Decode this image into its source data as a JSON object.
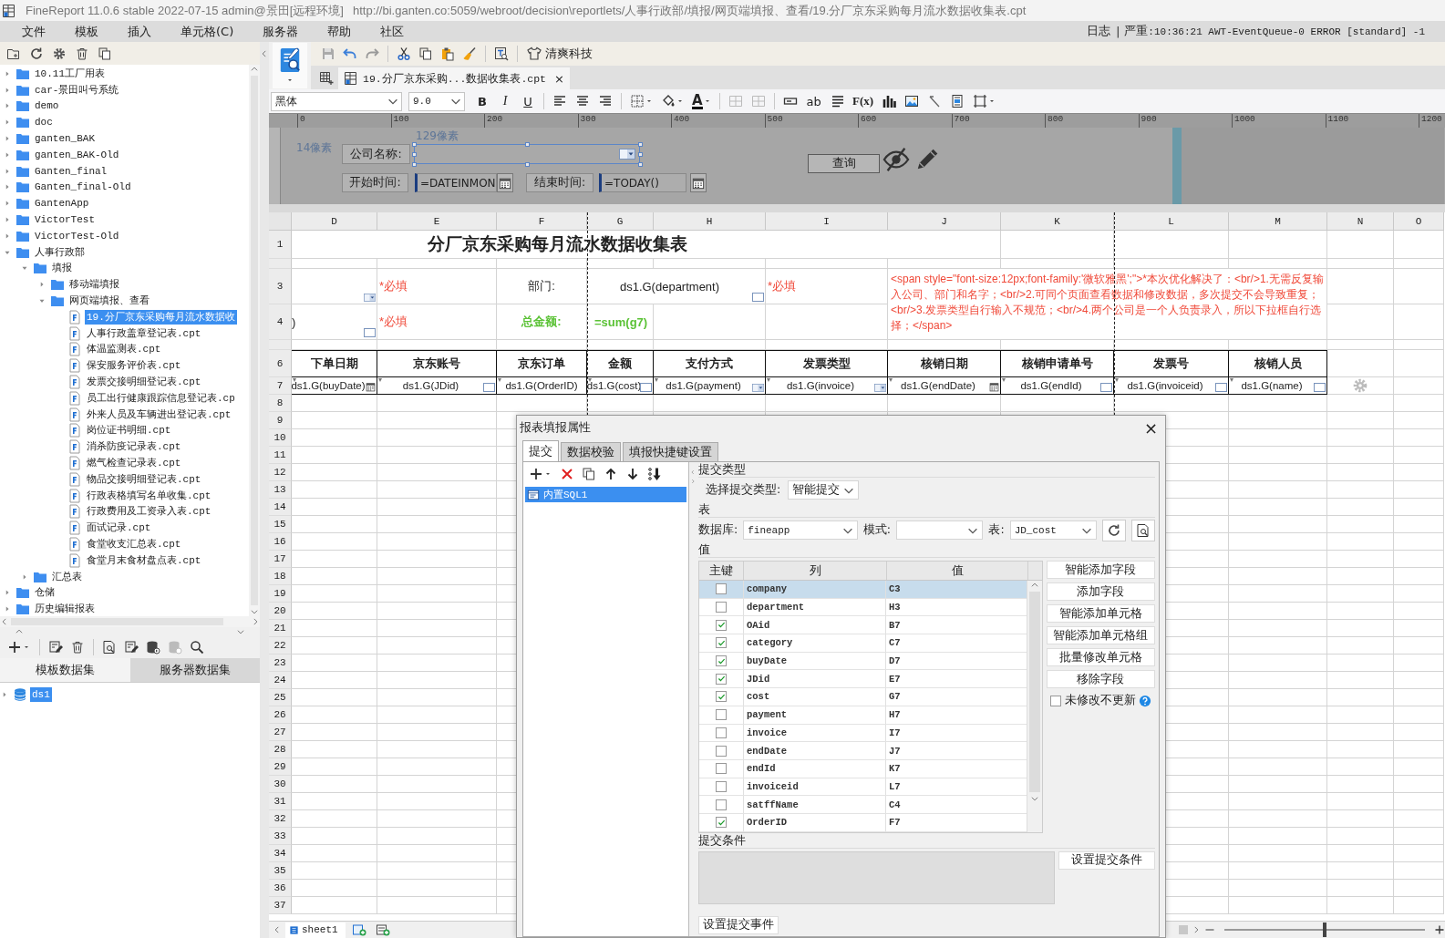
{
  "window": {
    "title": "FineReport 11.0.6 stable 2022-07-15 admin@景田[远程环境]",
    "url": "http://bi.ganten.co:5059/webroot/decision\\reportlets/人事行政部/填报/网页端填报、查看/19.分厂京东采购每月流水数据收集表.cpt"
  },
  "menu": {
    "items": [
      "文件",
      "模板",
      "插入",
      "单元格(C)",
      "服务器",
      "帮助",
      "社区"
    ],
    "log_label": "日志",
    "log_separator": "|",
    "log_level": "严重",
    "log_message": ":10:36:21 AWT-EventQueue-0 ERROR [standard] -1"
  },
  "template_tree": [
    {
      "label": "10.11工厂用表",
      "kind": "folder",
      "expanded": false,
      "selected": false
    },
    {
      "label": "car-景田叫号系统",
      "kind": "folder",
      "expanded": false,
      "selected": false
    },
    {
      "label": "demo",
      "kind": "folder",
      "expanded": false,
      "selected": false
    },
    {
      "label": "doc",
      "kind": "folder",
      "expanded": false,
      "selected": false
    },
    {
      "label": "ganten_BAK",
      "kind": "folder",
      "expanded": false,
      "selected": false
    },
    {
      "label": "ganten_BAK-Old",
      "kind": "folder",
      "expanded": false,
      "selected": false
    },
    {
      "label": "Ganten_final",
      "kind": "folder",
      "expanded": false,
      "selected": false
    },
    {
      "label": "Ganten_final-Old",
      "kind": "folder",
      "expanded": false,
      "selected": false
    },
    {
      "label": "GantenApp",
      "kind": "folder",
      "expanded": false,
      "selected": false
    },
    {
      "label": "VictorTest",
      "kind": "folder",
      "expanded": false,
      "selected": false
    },
    {
      "label": "VictorTest-Old",
      "kind": "folder",
      "expanded": false,
      "selected": false
    },
    {
      "label": "人事行政部",
      "kind": "folder",
      "expanded": true,
      "selected": false,
      "children": [
        {
          "label": "填报",
          "kind": "folder",
          "expanded": true,
          "selected": false,
          "children": [
            {
              "label": "移动端填报",
              "kind": "folder",
              "expanded": false,
              "selected": false
            },
            {
              "label": "网页端填报、查看",
              "kind": "folder",
              "expanded": true,
              "selected": false,
              "children": [
                {
                  "label": "19.分厂京东采购每月流水数据收",
                  "kind": "file",
                  "selected": true
                },
                {
                  "label": "人事行政盖章登记表.cpt",
                  "kind": "file",
                  "selected": false
                },
                {
                  "label": "体温监测表.cpt",
                  "kind": "file",
                  "selected": false
                },
                {
                  "label": "保安服务评价表.cpt",
                  "kind": "file",
                  "selected": false
                },
                {
                  "label": "发票交接明细登记表.cpt",
                  "kind": "file",
                  "selected": false
                },
                {
                  "label": "员工出行健康跟踪信息登记表.cp",
                  "kind": "file",
                  "selected": false
                },
                {
                  "label": "外来人员及车辆进出登记表.cpt",
                  "kind": "file",
                  "selected": false
                },
                {
                  "label": "岗位证书明细.cpt",
                  "kind": "file",
                  "selected": false
                },
                {
                  "label": "消杀防疫记录表.cpt",
                  "kind": "file",
                  "selected": false
                },
                {
                  "label": "燃气检查记录表.cpt",
                  "kind": "file",
                  "selected": false
                },
                {
                  "label": "物品交接明细登记表.cpt",
                  "kind": "file",
                  "selected": false
                },
                {
                  "label": "行政表格填写名单收集.cpt",
                  "kind": "file",
                  "selected": false
                },
                {
                  "label": "行政费用及工资录入表.cpt",
                  "kind": "file",
                  "selected": false
                },
                {
                  "label": "面试记录.cpt",
                  "kind": "file",
                  "selected": false
                },
                {
                  "label": "食堂收支汇总表.cpt",
                  "kind": "file",
                  "selected": false
                },
                {
                  "label": "食堂月末食材盘点表.cpt",
                  "kind": "file",
                  "selected": false
                }
              ]
            }
          ]
        },
        {
          "label": "汇总表",
          "kind": "folder",
          "expanded": false,
          "selected": false
        }
      ]
    },
    {
      "label": "仓储",
      "kind": "folder",
      "expanded": false,
      "selected": false
    },
    {
      "label": "历史编辑报表",
      "kind": "folder",
      "expanded": false,
      "selected": false
    }
  ],
  "dataset_tabs": [
    {
      "label": "模板数据集",
      "selected": true
    },
    {
      "label": "服务器数据集",
      "selected": false
    }
  ],
  "datasets": [
    {
      "label": "ds1",
      "selected": true,
      "expanded": false
    }
  ],
  "toolbar": {
    "style_label": "清爽科技"
  },
  "document_tab": {
    "label": "19.分厂京东采购...数据收集表.cpt",
    "close": "×"
  },
  "format_bar": {
    "font": "黑体",
    "size": "9.0",
    "bold": "B",
    "italic": "I",
    "underline": "U",
    "font_color": "A",
    "text_widget": "ab",
    "formula": "F(x)"
  },
  "ruler": [
    "0",
    "100",
    "200",
    "300",
    "400",
    "500",
    "600",
    "700",
    "800",
    "900",
    "1000",
    "1100",
    "1200"
  ],
  "parameter_panel": {
    "left_gap": "14像素",
    "widget_width": "129像素",
    "company_label": "公司名称:",
    "start_label": "开始时间:",
    "start_value": "=DATEINMON",
    "end_label": "结束时间:",
    "end_value": "=TODAY()",
    "query_button": "查询"
  },
  "sheet": {
    "columns": [
      "D",
      "E",
      "F",
      "G",
      "H",
      "I",
      "J",
      "K",
      "L",
      "M",
      "N",
      "O"
    ],
    "rows": [
      {
        "label": "1",
        "kind": "title",
        "cells": [
          {
            "kind": "title",
            "text": "分厂京东采购每月流水数据收集表"
          },
          {
            "kind": "joined"
          },
          {
            "kind": "joined"
          },
          {
            "kind": "joined"
          },
          {
            "kind": "joined"
          },
          {
            "kind": "joined"
          },
          {
            "kind": "joined"
          },
          {
            "kind": "blank"
          },
          {
            "kind": "blank"
          },
          {
            "kind": "blank"
          },
          {
            "kind": "blank"
          },
          {
            "kind": "blank"
          }
        ]
      },
      {
        "kind": "thin"
      },
      {
        "label": "3",
        "kind": "tall",
        "cells": [
          {
            "kind": "blank",
            "widget": {
              "kind": "dropdown"
            }
          },
          {
            "kind": "required",
            "text": "*必填"
          },
          {
            "kind": "label",
            "text": "部门:"
          },
          {
            "kind": "value",
            "text": "ds1.G(department)",
            "widget": {
              "kind": "text"
            }
          },
          {
            "kind": "joined"
          },
          {
            "kind": "required",
            "text": "*必填"
          },
          {
            "kind": "note",
            "text": "<span style=\"font-size:12px;font-family:'微软雅黑';\">*本次优化解决了：<br/>1.无需反复输入公司、部门和名字；<br/>2.可同个页面查看数据和修改数据，多次提交不会导致重复；<br/>3.发票类型自行输入不规范；<br/>4.两个公司是一个人负责录入，所以下拉框自行选择；</span>"
          },
          {
            "kind": "joined"
          },
          {
            "kind": "joined"
          },
          {
            "kind": "joined"
          },
          {
            "kind": "blank"
          },
          {
            "kind": "blank"
          }
        ]
      },
      {
        "label": "4",
        "kind": "tall",
        "cells": [
          {
            "kind": "overflow",
            "text": ")",
            "widget": {
              "kind": "text"
            }
          },
          {
            "kind": "required",
            "text": "*必填"
          },
          {
            "kind": "total-label",
            "text": "总金额:"
          },
          {
            "kind": "total",
            "text": "=sum(g7)"
          },
          {
            "kind": "blank"
          },
          {
            "kind": "blank"
          },
          {
            "kind": "joined-above"
          },
          {
            "kind": "joined-above"
          },
          {
            "kind": "joined-above"
          },
          {
            "kind": "joined-above"
          },
          {
            "kind": "blank"
          },
          {
            "kind": "blank"
          }
        ]
      },
      {
        "kind": "thin"
      },
      {
        "label": "6",
        "kind": "header",
        "cells": [
          {
            "kind": "header",
            "text": "下单日期"
          },
          {
            "kind": "header",
            "text": "京东账号"
          },
          {
            "kind": "header",
            "text": "京东订单"
          },
          {
            "kind": "header",
            "text": "金额"
          },
          {
            "kind": "header",
            "text": "支付方式"
          },
          {
            "kind": "header",
            "text": "发票类型"
          },
          {
            "kind": "header",
            "text": "核销日期"
          },
          {
            "kind": "header",
            "text": "核销申请单号"
          },
          {
            "kind": "header",
            "text": "发票号"
          },
          {
            "kind": "header",
            "text": "核销人员"
          },
          {
            "kind": "blank"
          },
          {
            "kind": "blank"
          }
        ]
      },
      {
        "label": "7",
        "kind": "normal",
        "cells": [
          {
            "kind": "formula",
            "text": "ds1.G(buyDate)",
            "widget": {
              "kind": "date"
            }
          },
          {
            "kind": "formula",
            "text": "ds1.G(JDid)",
            "widget": {
              "kind": "text"
            }
          },
          {
            "kind": "formula",
            "text": "ds1.G(OrderID)"
          },
          {
            "kind": "formula",
            "text": "ds1.G(cost)",
            "widget": {
              "kind": "text"
            }
          },
          {
            "kind": "formula",
            "text": "ds1.G(payment)",
            "widget": {
              "kind": "dropdown"
            }
          },
          {
            "kind": "formula",
            "text": "ds1.G(invoice)",
            "widget": {
              "kind": "dropdown"
            }
          },
          {
            "kind": "formula",
            "text": "ds1.G(endDate)",
            "widget": {
              "kind": "date"
            }
          },
          {
            "kind": "formula",
            "text": "ds1.G(endId)",
            "widget": {
              "kind": "text"
            }
          },
          {
            "kind": "formula",
            "text": "ds1.G(invoiceid)",
            "widget": {
              "kind": "text"
            }
          },
          {
            "kind": "formula",
            "text": "ds1.G(name)",
            "widget": {
              "kind": "text"
            }
          },
          {
            "kind": "gear"
          },
          {
            "kind": "blank"
          }
        ]
      },
      {
        "label": "8",
        "kind": "normal"
      },
      {
        "label": "9",
        "kind": "normal"
      },
      {
        "label": "10",
        "kind": "normal"
      },
      {
        "label": "11",
        "kind": "normal"
      },
      {
        "label": "12",
        "kind": "normal"
      },
      {
        "label": "13",
        "kind": "normal"
      },
      {
        "label": "14",
        "kind": "normal"
      },
      {
        "label": "15",
        "kind": "normal"
      },
      {
        "label": "16",
        "kind": "normal"
      },
      {
        "label": "17",
        "kind": "normal"
      },
      {
        "label": "18",
        "kind": "normal"
      },
      {
        "label": "19",
        "kind": "normal"
      },
      {
        "label": "20",
        "kind": "normal"
      },
      {
        "label": "21",
        "kind": "normal"
      },
      {
        "label": "22",
        "kind": "normal"
      },
      {
        "label": "23",
        "kind": "normal"
      },
      {
        "label": "24",
        "kind": "normal"
      },
      {
        "label": "25",
        "kind": "normal"
      },
      {
        "label": "26",
        "kind": "normal"
      },
      {
        "label": "27",
        "kind": "normal"
      },
      {
        "label": "28",
        "kind": "normal"
      },
      {
        "label": "29",
        "kind": "normal"
      },
      {
        "label": "30",
        "kind": "normal"
      },
      {
        "label": "31",
        "kind": "normal"
      },
      {
        "label": "32",
        "kind": "normal"
      },
      {
        "label": "33",
        "kind": "normal"
      },
      {
        "label": "34",
        "kind": "normal"
      },
      {
        "label": "35",
        "kind": "normal"
      },
      {
        "label": "36",
        "kind": "normal"
      },
      {
        "label": "37",
        "kind": "normal"
      }
    ]
  },
  "sheet_tabs": [
    {
      "label": "sheet1",
      "selected": true
    }
  ],
  "zoom": {
    "level": 0.5
  },
  "dialog": {
    "title": "报表填报属性",
    "close": "×",
    "tabs": [
      {
        "label": "提交",
        "selected": true
      },
      {
        "label": "数据校验",
        "selected": false
      },
      {
        "label": "填报快捷键设置",
        "selected": false
      }
    ],
    "submit_items": [
      {
        "label": "内置SQL1",
        "selected": true
      }
    ],
    "submit_type": {
      "section": "提交类型",
      "label": "选择提交类型:",
      "value": "智能提交"
    },
    "table_section": {
      "section": "表",
      "database_label": "数据库:",
      "database": "fineapp",
      "schema_label": "模式:",
      "table_label": "表:",
      "table": "JD_cost"
    },
    "values": {
      "section": "值",
      "columns": [
        "主键",
        "列",
        "值"
      ],
      "rows": [
        {
          "primary_key": false,
          "column": "company",
          "value": "C3",
          "selected": true
        },
        {
          "primary_key": false,
          "column": "department",
          "value": "H3",
          "selected": false
        },
        {
          "primary_key": true,
          "column": "OAid",
          "value": "B7",
          "selected": false
        },
        {
          "primary_key": true,
          "column": "category",
          "value": "C7",
          "selected": false
        },
        {
          "primary_key": true,
          "column": "buyDate",
          "value": "D7",
          "selected": false
        },
        {
          "primary_key": true,
          "column": "JDid",
          "value": "E7",
          "selected": false
        },
        {
          "primary_key": true,
          "column": "cost",
          "value": "G7",
          "selected": false
        },
        {
          "primary_key": false,
          "column": "payment",
          "value": "H7",
          "selected": false
        },
        {
          "primary_key": false,
          "column": "invoice",
          "value": "I7",
          "selected": false
        },
        {
          "primary_key": false,
          "column": "endDate",
          "value": "J7",
          "selected": false
        },
        {
          "primary_key": false,
          "column": "endId",
          "value": "K7",
          "selected": false
        },
        {
          "primary_key": false,
          "column": "invoiceid",
          "value": "L7",
          "selected": false
        },
        {
          "primary_key": false,
          "column": "satffName",
          "value": "C4",
          "selected": false
        },
        {
          "primary_key": true,
          "column": "OrderID",
          "value": "F7",
          "selected": false
        }
      ],
      "buttons": [
        "智能添加字段",
        "添加字段",
        "智能添加单元格",
        "智能添加单元格组",
        "批量修改单元格",
        "移除字段"
      ],
      "skip_unchanged": {
        "label": "未修改不更新",
        "checked": false
      }
    },
    "condition": {
      "section": "提交条件",
      "button": "设置提交条件"
    },
    "event_button": "设置提交事件"
  }
}
